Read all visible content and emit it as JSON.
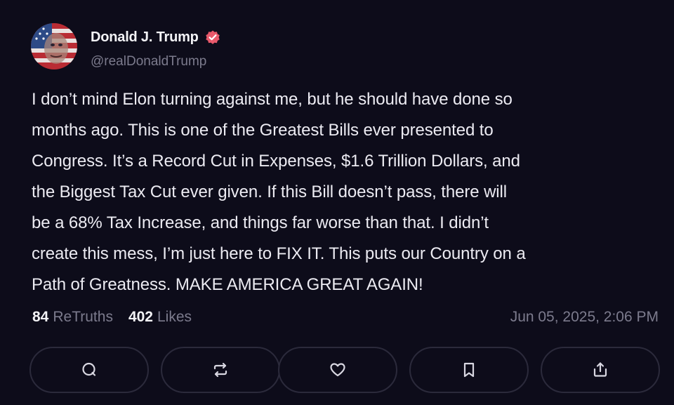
{
  "author": {
    "name": "Donald J. Trump",
    "handle": "@realDonaldTrump",
    "verified_color": "#e8596b"
  },
  "post": {
    "lines": [
      "I don’t mind Elon turning against me, but he should have done so",
      "months ago. This is one of the Greatest Bills ever presented to",
      "Congress. It’s a Record Cut in Expenses, $1.6 Trillion Dollars, and",
      "the Biggest Tax Cut ever given. If this Bill doesn’t pass, there will",
      "be a 68% Tax Increase, and things far worse than that. I didn’t",
      "create this mess, I’m just here to FIX IT. This puts our Country on a",
      "Path of Greatness. MAKE AMERICA GREAT AGAIN!"
    ]
  },
  "stats": {
    "retruths_count": "84",
    "retruths_label": "ReTruths",
    "likes_count": "402",
    "likes_label": "Likes"
  },
  "timestamp": "Jun 05, 2025, 2:06 PM",
  "actions": [
    {
      "icon": "reply-icon"
    },
    {
      "icon": "retruth-icon"
    },
    {
      "icon": "like-icon"
    },
    {
      "icon": "bookmark-icon"
    },
    {
      "icon": "share-icon"
    }
  ]
}
